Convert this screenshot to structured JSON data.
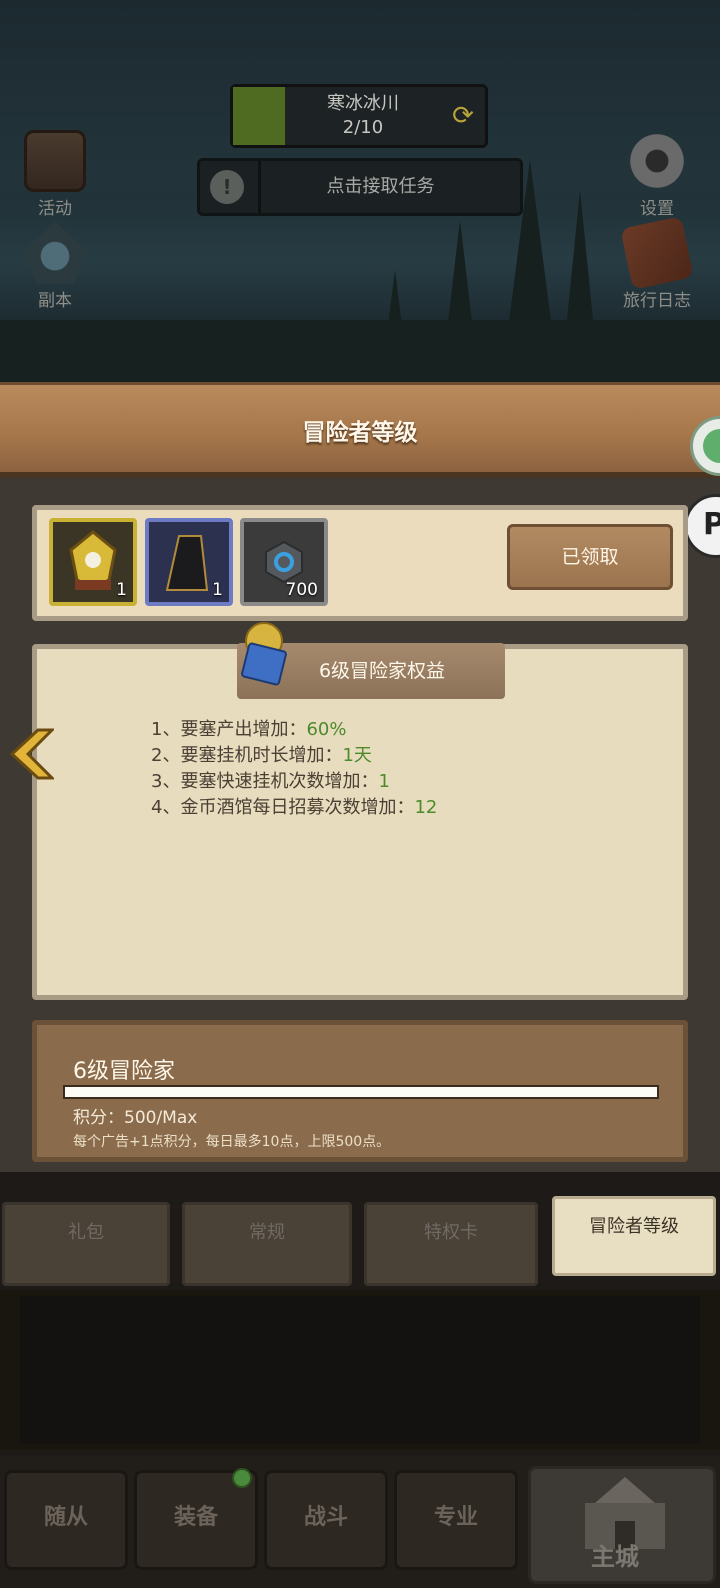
{
  "hud": {
    "zone_name": "寒冰冰川",
    "zone_progress": "2/10",
    "task_prompt": "点击接取任务",
    "left_buttons": [
      {
        "label": "活动",
        "icon": "activity-chest-icon"
      },
      {
        "label": "副本",
        "icon": "dungeon-portal-icon"
      }
    ],
    "right_buttons": [
      {
        "label": "设置",
        "icon": "gear-icon"
      },
      {
        "label": "旅行日志",
        "icon": "travel-log-book-icon"
      }
    ]
  },
  "panel": {
    "title": "冒险者等级",
    "rewards": [
      {
        "icon": "golden-emblem-icon",
        "quantity": "1",
        "rarity": "gold"
      },
      {
        "icon": "dark-cloak-icon",
        "quantity": "1",
        "rarity": "blue"
      },
      {
        "icon": "blue-gem-stone-icon",
        "quantity": "700",
        "rarity": "grey"
      }
    ],
    "claim_button": "已领取",
    "benefits_title": "6级冒险家权益",
    "benefits": [
      {
        "text": "1、要塞产出增加：",
        "value": "60%"
      },
      {
        "text": "2、要塞挂机时长增加：",
        "value": "1天"
      },
      {
        "text": "3、要塞快速挂机次数增加：",
        "value": "1"
      },
      {
        "text": "4、金币酒馆每日招募次数增加：",
        "value": "12"
      }
    ],
    "level_name": "6级冒险家",
    "progress_fraction": 1.0,
    "points_text": "积分：500/Max",
    "note": "每个广告+1点积分，每日最多10点，上限500点。"
  },
  "tabs": [
    {
      "label": "礼包",
      "active": false
    },
    {
      "label": "常规",
      "active": false
    },
    {
      "label": "特权卡",
      "active": false
    },
    {
      "label": "冒险者等级",
      "active": true
    }
  ],
  "bottom_nav": [
    {
      "label": "随从"
    },
    {
      "label": "装备"
    },
    {
      "label": "战斗"
    },
    {
      "label": "专业"
    },
    {
      "label": "主城"
    }
  ],
  "colors": {
    "accent_green": "#4c8a2a",
    "header_wood": "#a4764a",
    "parchment": "#e8dcbf"
  }
}
